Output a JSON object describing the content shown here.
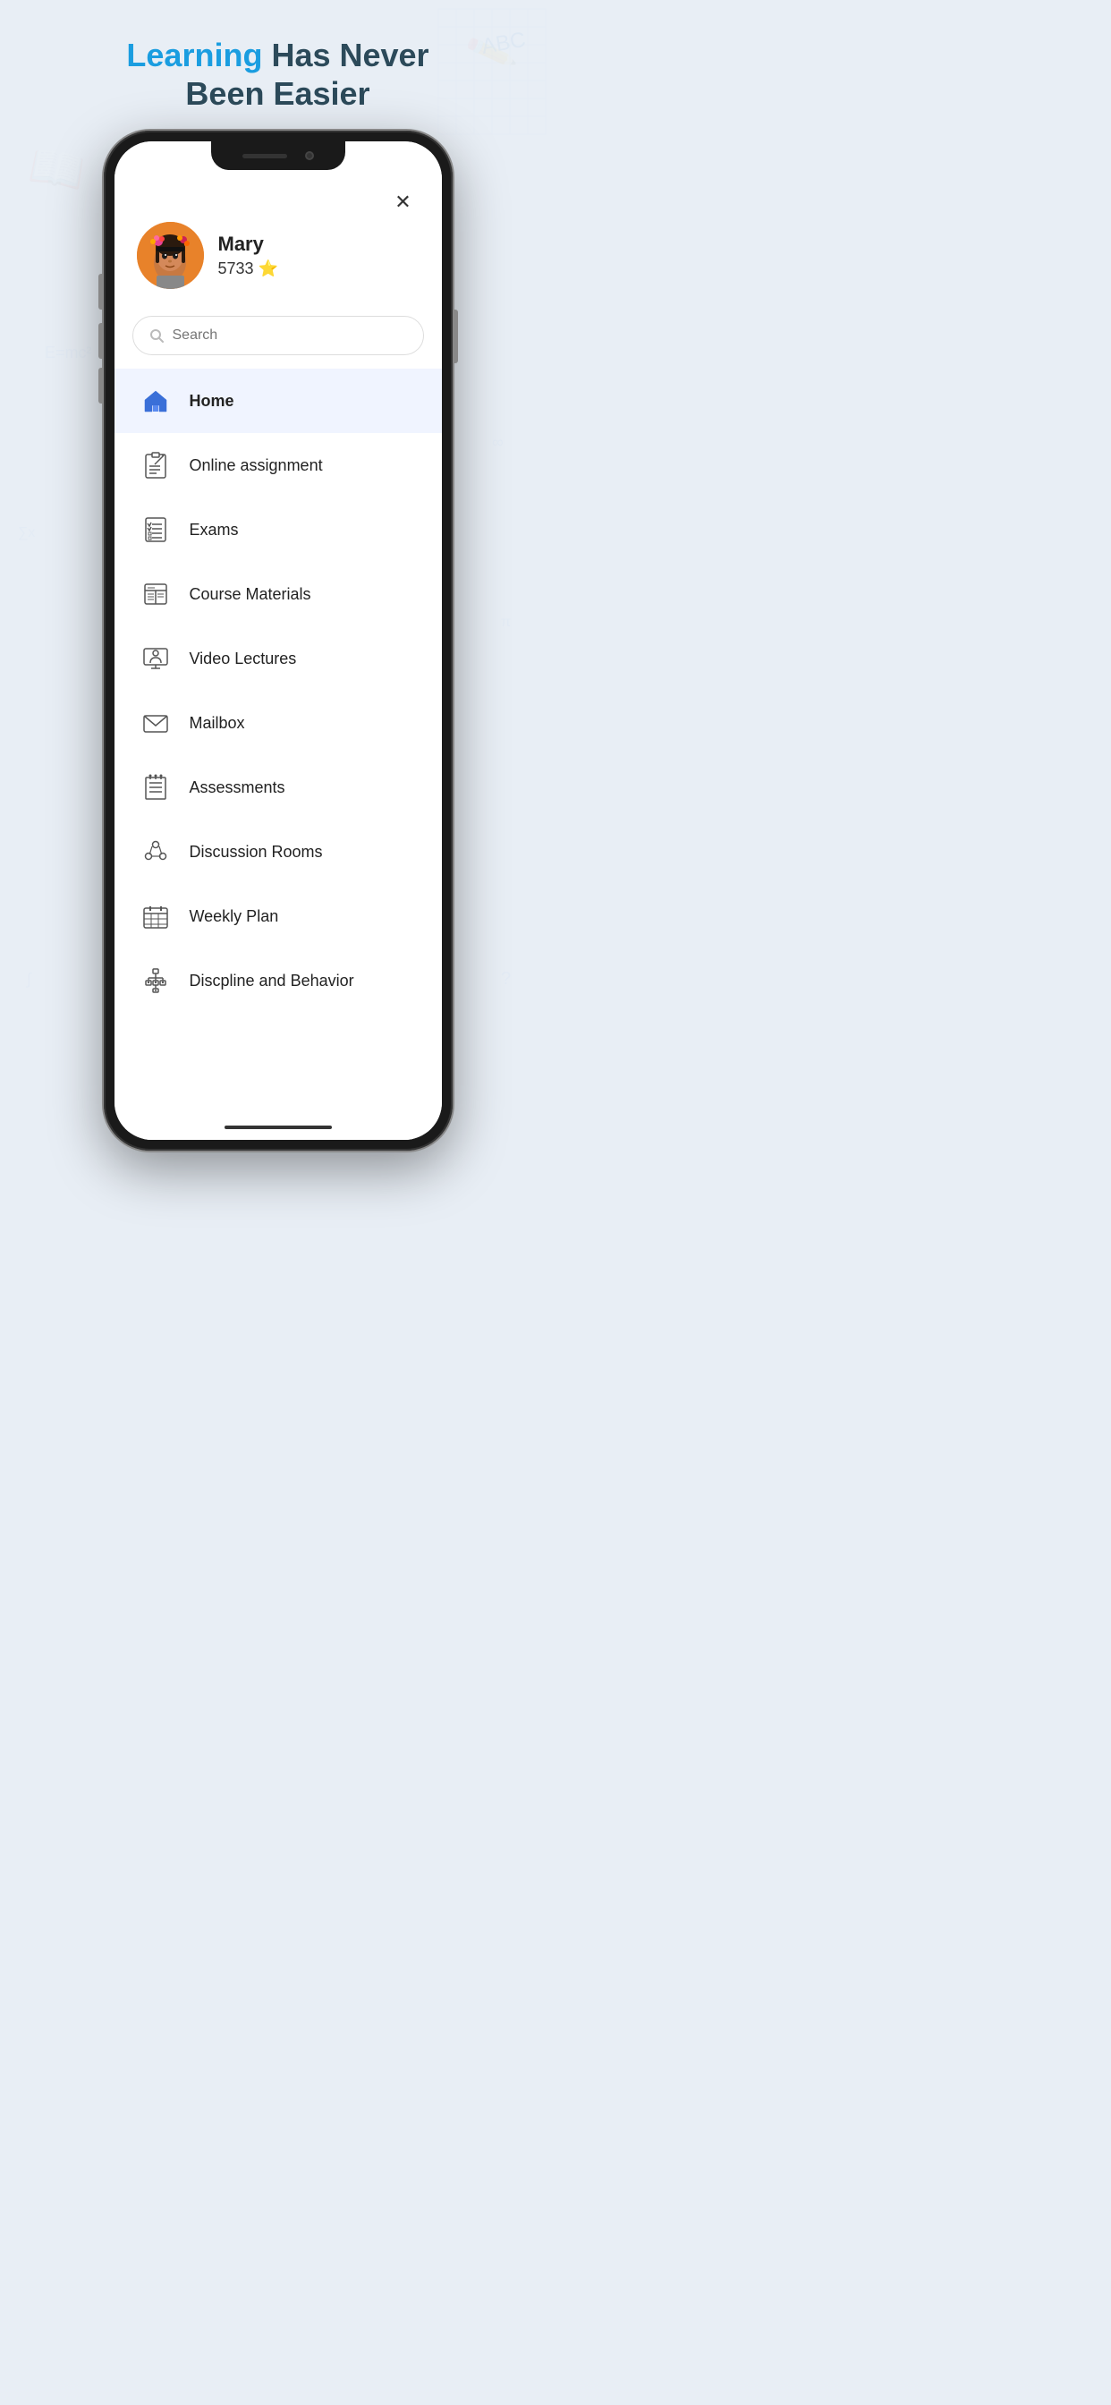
{
  "header": {
    "learning": "Learning",
    "rest": " Has Never\nBeen Easier"
  },
  "profile": {
    "name": "Mary",
    "points": "5733",
    "star": "⭐"
  },
  "search": {
    "placeholder": "Search"
  },
  "close_label": "✕",
  "menu": [
    {
      "id": "home",
      "label": "Home",
      "icon": "home"
    },
    {
      "id": "online-assignment",
      "label": "Online assignment",
      "icon": "assignment"
    },
    {
      "id": "exams",
      "label": "Exams",
      "icon": "exams"
    },
    {
      "id": "course-materials",
      "label": "Course Materials",
      "icon": "course"
    },
    {
      "id": "video-lectures",
      "label": "Video Lectures",
      "icon": "video"
    },
    {
      "id": "mailbox",
      "label": "Mailbox",
      "icon": "mail"
    },
    {
      "id": "assessments",
      "label": "Assessments",
      "icon": "assessments"
    },
    {
      "id": "discussion-rooms",
      "label": "Discussion Rooms",
      "icon": "discussion"
    },
    {
      "id": "weekly-plan",
      "label": "Weekly Plan",
      "icon": "calendar"
    },
    {
      "id": "discipline-behavior",
      "label": "Discpline and Behavior",
      "icon": "discipline"
    }
  ]
}
